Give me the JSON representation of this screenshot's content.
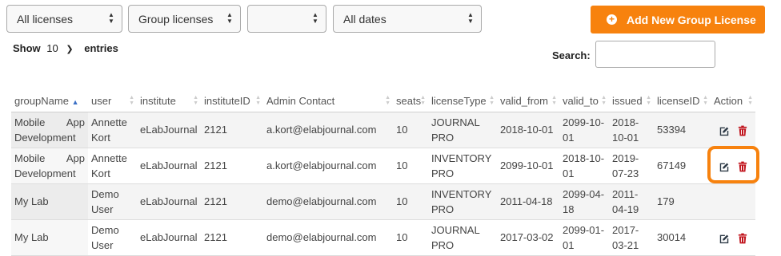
{
  "filters": [
    {
      "value": "All licenses"
    },
    {
      "value": "Group licenses"
    },
    {
      "value": ""
    },
    {
      "value": "All dates"
    }
  ],
  "add_button": {
    "label": "Add New Group License"
  },
  "length": {
    "show": "Show",
    "value": "10",
    "entries": "entries"
  },
  "search": {
    "label": "Search:",
    "value": ""
  },
  "columns": [
    "groupName",
    "user",
    "institute",
    "instituteID",
    "Admin Contact",
    "seats",
    "licenseType",
    "valid_from",
    "valid_to",
    "issued",
    "licenseID",
    "Action"
  ],
  "rows": [
    {
      "groupName": "Mobile App Development",
      "user": "Annette Kort",
      "institute": "eLabJournal",
      "instituteID": "2121",
      "admin": "a.kort@elabjournal.com",
      "seats": "10",
      "licenseType": "JOURNAL PRO",
      "valid_from": "2018-10-01",
      "valid_to": "2099-10-01",
      "issued": "2018-10-01",
      "licenseID": "53394"
    },
    {
      "groupName": "Mobile App Development",
      "user": "Annette Kort",
      "institute": "eLabJournal",
      "instituteID": "2121",
      "admin": "a.kort@elabjournal.com",
      "seats": "10",
      "licenseType": "INVENTORY PRO",
      "valid_from": "2099-10-01",
      "valid_to": "2018-10-01",
      "issued": "2019-07-23",
      "licenseID": "67149"
    },
    {
      "groupName": "My Lab",
      "user": "Demo User",
      "institute": "eLabJournal",
      "instituteID": "2121",
      "admin": "demo@elabjournal.com",
      "seats": "10",
      "licenseType": "INVENTORY PRO",
      "valid_from": "2011-04-18",
      "valid_to": "2099-04-18",
      "issued": "2011-04-19",
      "licenseID": "179"
    },
    {
      "groupName": "My Lab",
      "user": "Demo User",
      "institute": "eLabJournal",
      "instituteID": "2121",
      "admin": "demo@elabjournal.com",
      "seats": "10",
      "licenseType": "JOURNAL PRO",
      "valid_from": "2017-03-02",
      "valid_to": "2099-01-01",
      "issued": "2017-03-21",
      "licenseID": "30014"
    }
  ],
  "icons": {
    "edit": "edit-icon",
    "delete": "trash-icon",
    "add": "plus-circle-icon"
  },
  "colors": {
    "accent": "#f7820e",
    "delete": "#c0121b",
    "edit": "#2e3a46",
    "sort_active": "#3a6fc5"
  }
}
